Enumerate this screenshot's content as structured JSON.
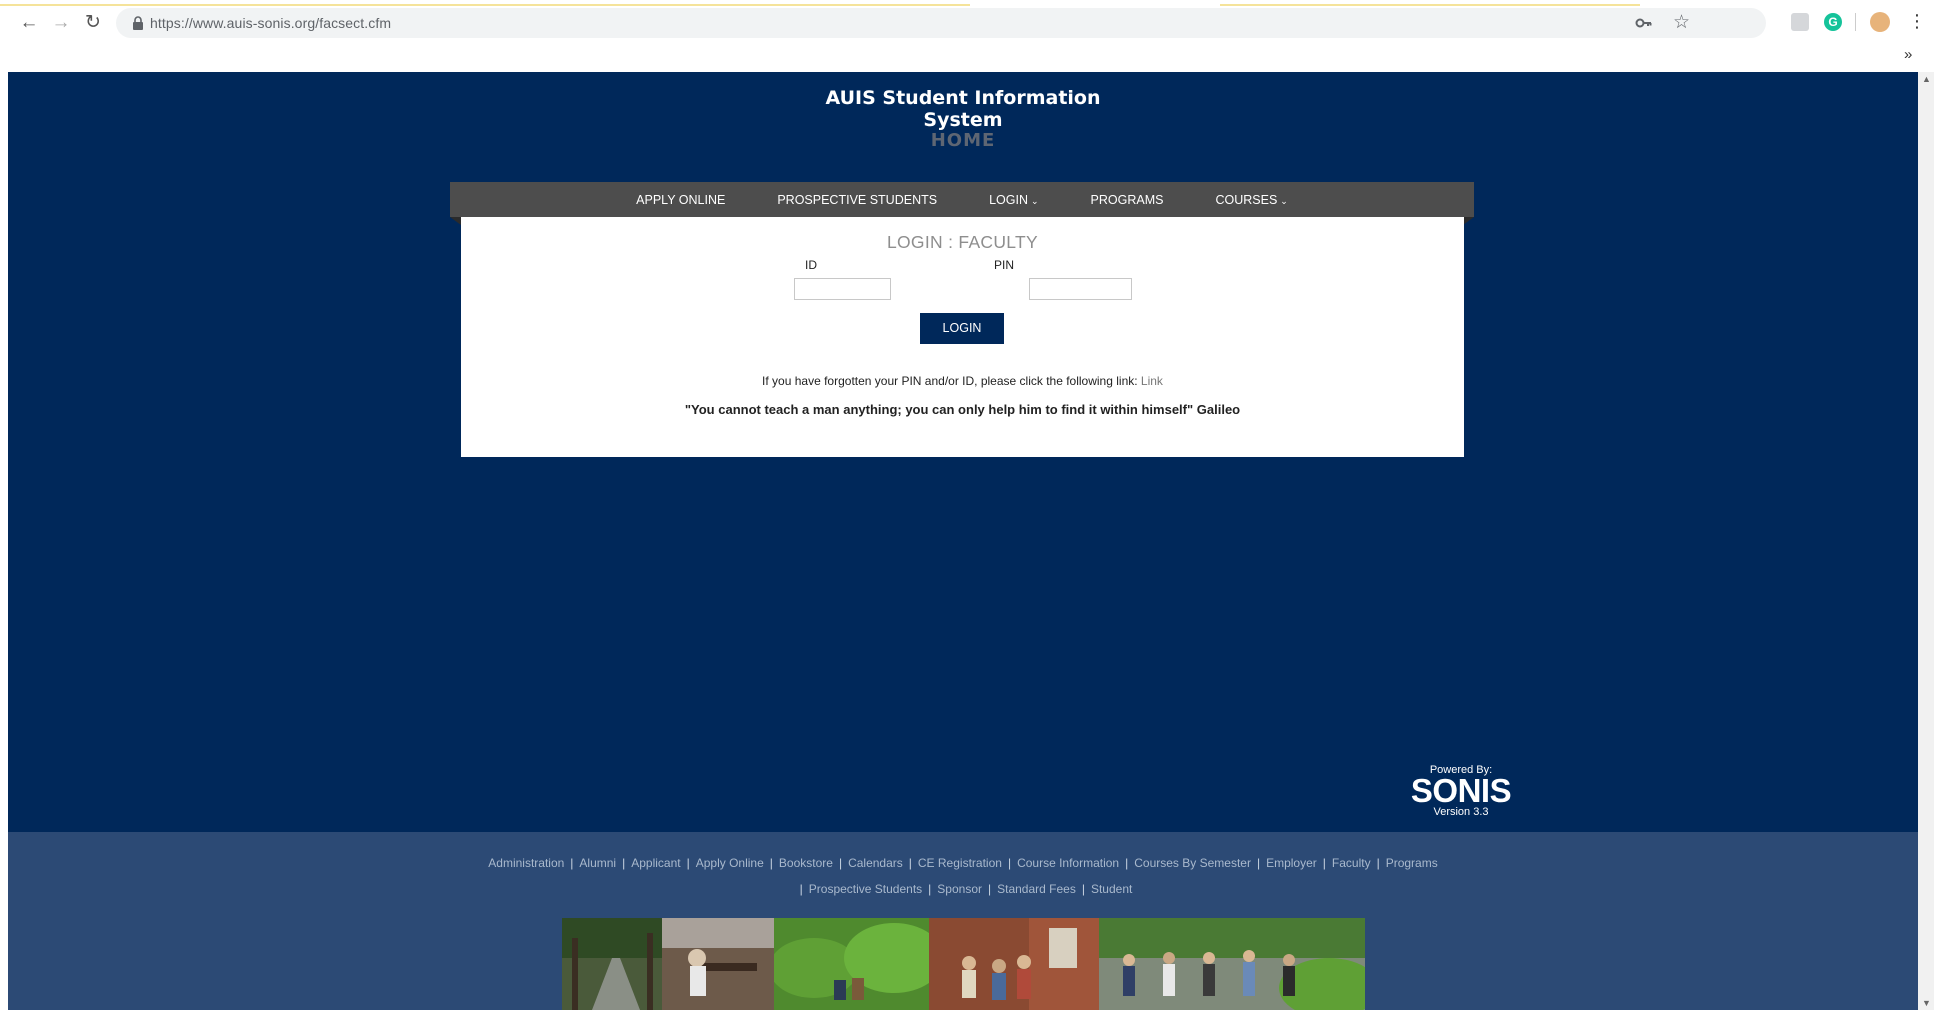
{
  "browser": {
    "url": "https://www.auis-sonis.org/facsect.cfm",
    "more_glyph": "»",
    "menu_glyph": "⋮"
  },
  "site": {
    "title_line1": "AUIS Student Information",
    "title_line2": "System",
    "subtitle": "HOME"
  },
  "nav": {
    "items": [
      {
        "label": "APPLY ONLINE",
        "dropdown": false
      },
      {
        "label": "PROSPECTIVE STUDENTS",
        "dropdown": false
      },
      {
        "label": "LOGIN",
        "dropdown": true
      },
      {
        "label": "PROGRAMS",
        "dropdown": false
      },
      {
        "label": "COURSES",
        "dropdown": true
      }
    ]
  },
  "login": {
    "heading": "LOGIN : FACULTY",
    "id_label": "ID",
    "pin_label": "PIN",
    "id_value": "",
    "pin_value": "",
    "button_label": "LOGIN",
    "forgot_text": "If you have forgotten your PIN and/or ID, please click the following link: ",
    "forgot_link": "Link",
    "quote": "\"You cannot teach a man anything; you can only help him to find it within himself\" Galileo"
  },
  "powered": {
    "label": "Powered By:",
    "brand": "SONIS",
    "version": "Version 3.3"
  },
  "footer": {
    "row1": [
      "Administration",
      "Alumni",
      "Applicant",
      "Apply Online",
      "Bookstore",
      "Calendars",
      "CE Registration",
      "Course Information",
      "Courses By Semester",
      "Employer",
      "Faculty",
      "Programs"
    ],
    "row2": [
      "Prospective Students",
      "Sponsor",
      "Standard Fees",
      "Student"
    ]
  },
  "colors": {
    "page_bg": "#00285a",
    "navbar_bg": "#4d4d4d",
    "footer_bg": "#2c4a75",
    "button_bg": "#00285a"
  }
}
